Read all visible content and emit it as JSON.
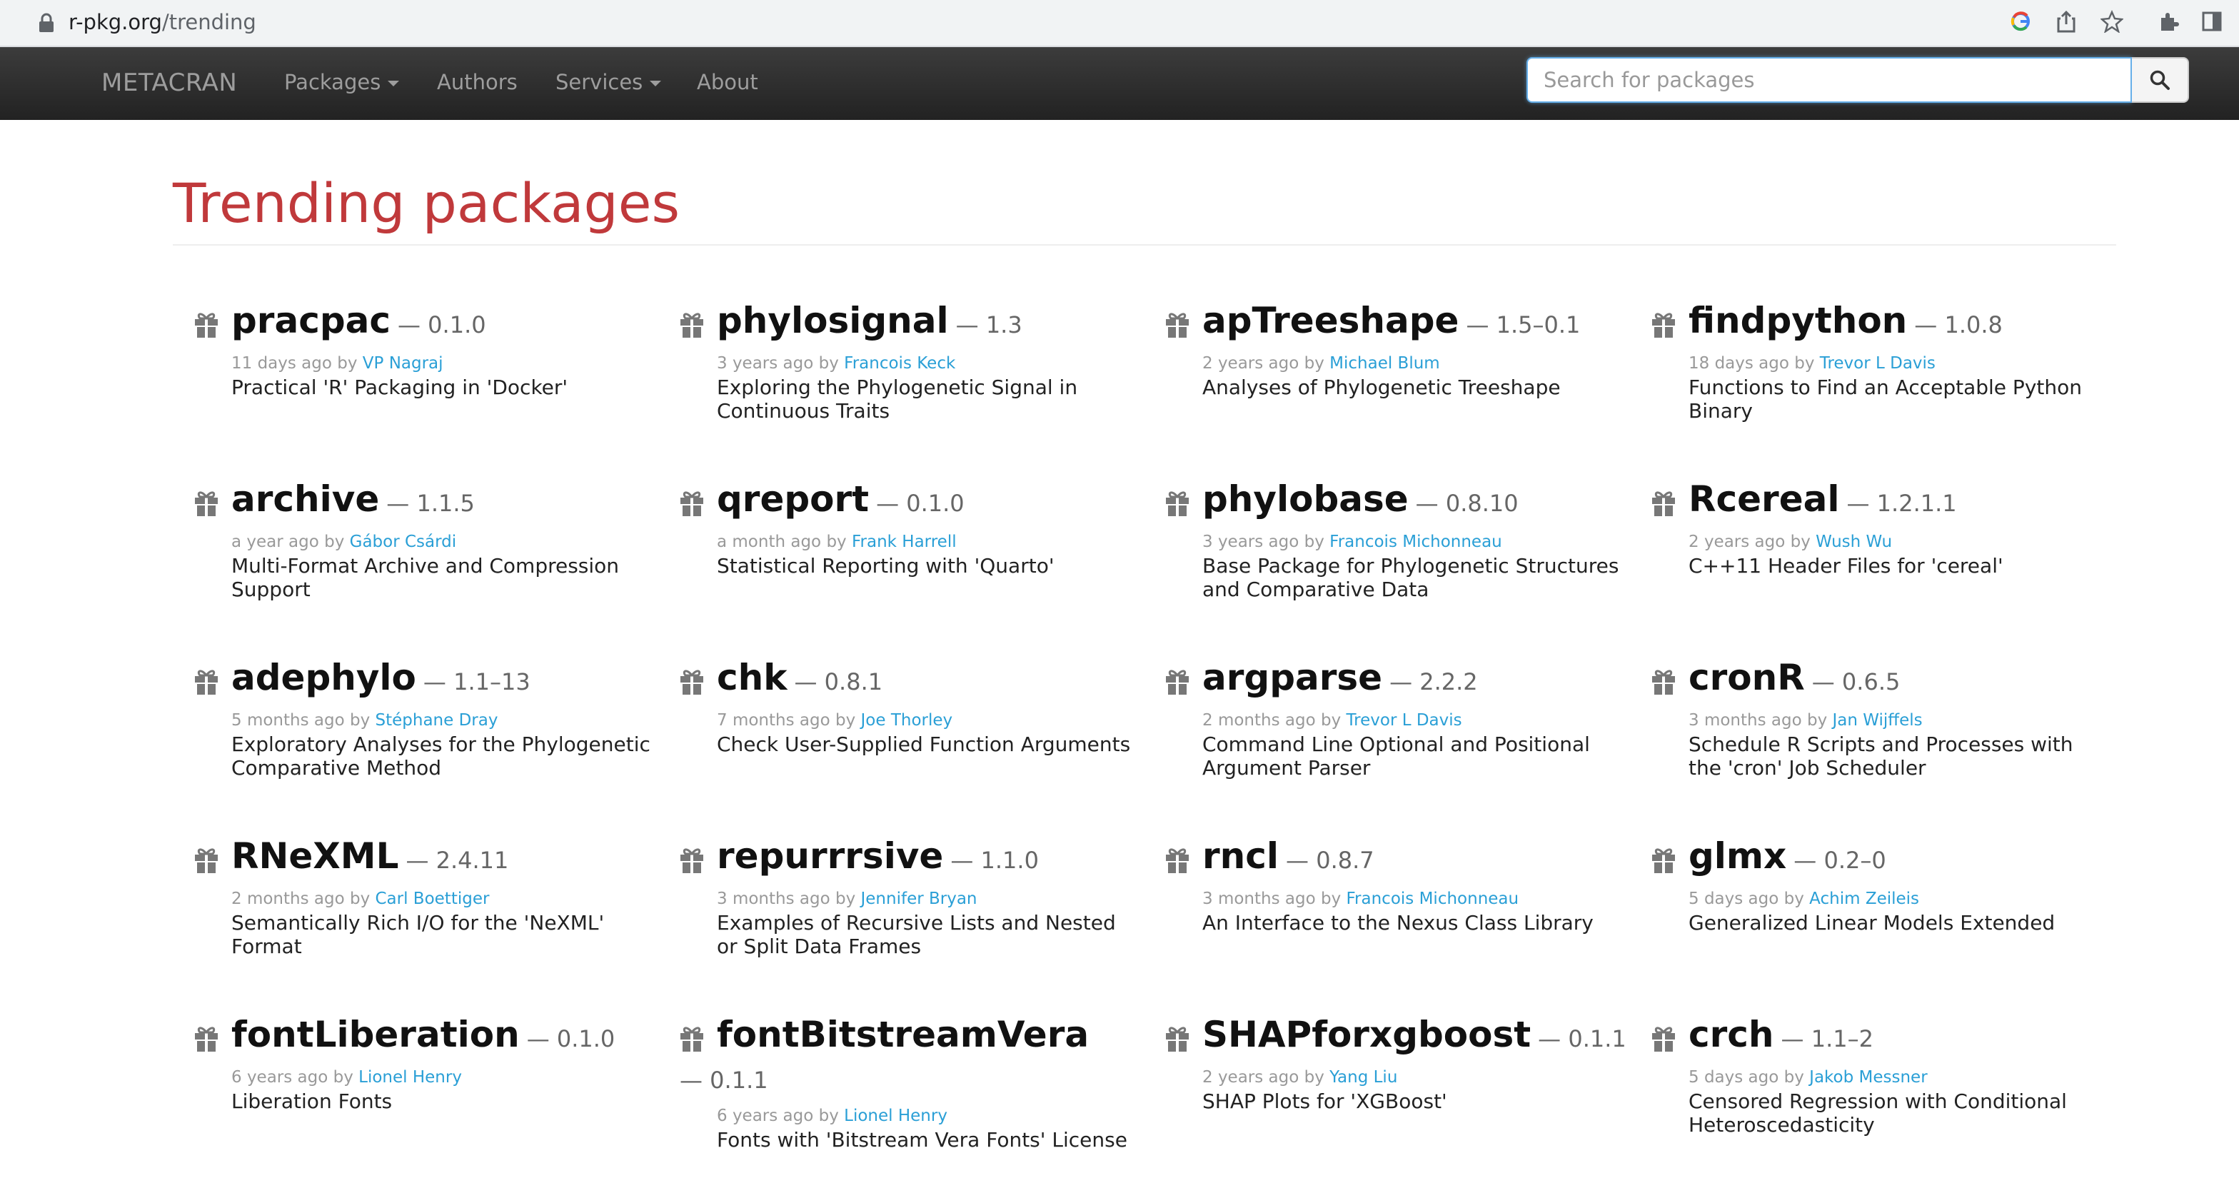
{
  "browser": {
    "url_host": "r-pkg.org",
    "url_path": "/trending"
  },
  "navbar": {
    "brand": "METACRAN",
    "items": [
      {
        "label": "Packages",
        "dropdown": true
      },
      {
        "label": "Authors",
        "dropdown": false
      },
      {
        "label": "Services",
        "dropdown": true
      },
      {
        "label": "About",
        "dropdown": false
      }
    ],
    "search_placeholder": "Search for packages"
  },
  "page": {
    "title": "Trending packages"
  },
  "colors": {
    "title": "#c0393b",
    "link": "#2a9fd6",
    "navbar": "#222222"
  },
  "packages": [
    {
      "name": "pracpac",
      "version": "— 0.1.0",
      "age": "11 days ago by ",
      "author": "VP Nagraj",
      "desc": "Practical 'R' Packaging in 'Docker'"
    },
    {
      "name": "phylosignal",
      "version": "— 1.3",
      "age": "3 years ago by ",
      "author": "Francois Keck",
      "desc": "Exploring the Phylogenetic Signal in Continuous Traits"
    },
    {
      "name": "apTreeshape",
      "version": "— 1.5–0.1",
      "age": "2 years ago by ",
      "author": "Michael Blum",
      "desc": "Analyses of Phylogenetic Treeshape"
    },
    {
      "name": "findpython",
      "version": "— 1.0.8",
      "age": "18 days ago by ",
      "author": "Trevor L Davis",
      "desc": "Functions to Find an Acceptable Python Binary"
    },
    {
      "name": "archive",
      "version": "— 1.1.5",
      "age": "a year ago by ",
      "author": "Gábor Csárdi",
      "desc": "Multi-Format Archive and Compression Support"
    },
    {
      "name": "qreport",
      "version": "— 0.1.0",
      "age": "a month ago by ",
      "author": "Frank Harrell",
      "desc": "Statistical Reporting with 'Quarto'"
    },
    {
      "name": "phylobase",
      "version": "— 0.8.10",
      "age": "3 years ago by ",
      "author": "Francois Michonneau",
      "desc": "Base Package for Phylogenetic Structures and Comparative Data"
    },
    {
      "name": "Rcereal",
      "version": "— 1.2.1.1",
      "age": "2 years ago by ",
      "author": "Wush Wu",
      "desc": "C++11 Header Files for 'cereal'"
    },
    {
      "name": "adephylo",
      "version": "— 1.1–13",
      "age": "5 months ago by ",
      "author": "Stéphane Dray",
      "desc": "Exploratory Analyses for the Phylogenetic Comparative Method"
    },
    {
      "name": "chk",
      "version": "— 0.8.1",
      "age": "7 months ago by ",
      "author": "Joe Thorley",
      "desc": "Check User-Supplied Function Arguments"
    },
    {
      "name": "argparse",
      "version": "— 2.2.2",
      "age": "2 months ago by ",
      "author": "Trevor L Davis",
      "desc": "Command Line Optional and Positional Argument Parser"
    },
    {
      "name": "cronR",
      "version": "— 0.6.5",
      "age": "3 months ago by ",
      "author": "Jan Wijffels",
      "desc": "Schedule R Scripts and Processes with the 'cron' Job Scheduler"
    },
    {
      "name": "RNeXML",
      "version": "— 2.4.11",
      "age": "2 months ago by ",
      "author": "Carl Boettiger",
      "desc": "Semantically Rich I/O for the 'NeXML' Format"
    },
    {
      "name": "repurrrsive",
      "version": "— 1.1.0",
      "age": "3 months ago by ",
      "author": "Jennifer Bryan",
      "desc": "Examples of Recursive Lists and Nested or Split Data Frames"
    },
    {
      "name": "rncl",
      "version": "— 0.8.7",
      "age": "3 months ago by ",
      "author": "Francois Michonneau",
      "desc": "An Interface to the Nexus Class Library"
    },
    {
      "name": "glmx",
      "version": "— 0.2–0",
      "age": "5 days ago by ",
      "author": "Achim Zeileis",
      "desc": "Generalized Linear Models Extended"
    },
    {
      "name": "fontLiberation",
      "version": "— 0.1.0",
      "age": "6 years ago by ",
      "author": "Lionel Henry",
      "desc": "Liberation Fonts"
    },
    {
      "name": "fontBitstreamVera",
      "version": "— 0.1.1",
      "age": "6 years ago by ",
      "author": "Lionel Henry",
      "desc": "Fonts with 'Bitstream Vera Fonts' License",
      "wrap": true
    },
    {
      "name": "SHAPforxgboost",
      "version": "— 0.1.1",
      "age": "2 years ago by ",
      "author": "Yang Liu",
      "desc": "SHAP Plots for 'XGBoost'"
    },
    {
      "name": "crch",
      "version": "— 1.1–2",
      "age": "5 days ago by ",
      "author": "Jakob Messner",
      "desc": "Censored Regression with Conditional Heteroscedasticity"
    }
  ]
}
